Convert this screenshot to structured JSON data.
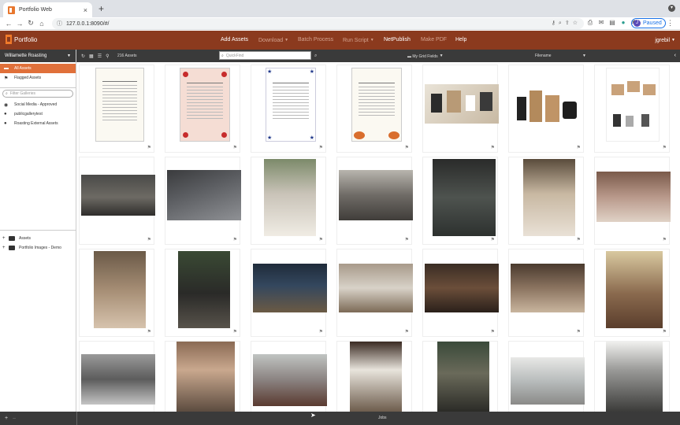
{
  "browser": {
    "tab_title": "Portfolio Web",
    "tab_close": "×",
    "new_tab": "+",
    "url": "127.0.0.1:8090/#/",
    "profile_initial": "J",
    "profile_status": "Paused"
  },
  "app": {
    "logo_text": "Portfolio",
    "menu": [
      {
        "label": "Add Assets",
        "enabled": true,
        "dropdown": false
      },
      {
        "label": "Download",
        "enabled": false,
        "dropdown": true
      },
      {
        "label": "Batch Process",
        "enabled": false,
        "dropdown": false
      },
      {
        "label": "Run Script",
        "enabled": false,
        "dropdown": true
      },
      {
        "label": "NetPublish",
        "enabled": true,
        "dropdown": false
      },
      {
        "label": "Make PDF",
        "enabled": false,
        "dropdown": false
      },
      {
        "label": "Help",
        "enabled": true,
        "dropdown": false
      }
    ],
    "user": "jgrebil"
  },
  "sidebar": {
    "catalog": "Willamette Roasting",
    "items": [
      {
        "label": "All Assets",
        "icon": "all-assets-icon",
        "active": true
      },
      {
        "label": "Flagged Assets",
        "icon": "flag-icon",
        "active": false
      }
    ],
    "filter_placeholder": "Filter Galleries",
    "galleries": [
      {
        "label": "Social Media - Approved",
        "icon": "eye-icon"
      },
      {
        "label": "publicgallerytest",
        "icon": "person-icon"
      },
      {
        "label": "Roasting External Assets",
        "icon": "person-icon"
      }
    ],
    "tree": [
      {
        "label": "Assets"
      },
      {
        "label": "Portfolio Images - Demo"
      }
    ]
  },
  "toolbar": {
    "asset_count": "216 Assets",
    "quickfind_placeholder": "QuickFind",
    "grid_fields": "My Grid Fields",
    "sort_field": "Filename"
  },
  "grid": {
    "rows": 4,
    "columns": 7
  },
  "bottom": {
    "jobs_label": "Jobs",
    "add": "+",
    "remove": "–"
  },
  "colors": {
    "brand_bar": "#8b3a1e",
    "accent": "#e0703a",
    "toolbar": "#3a3a3a"
  }
}
